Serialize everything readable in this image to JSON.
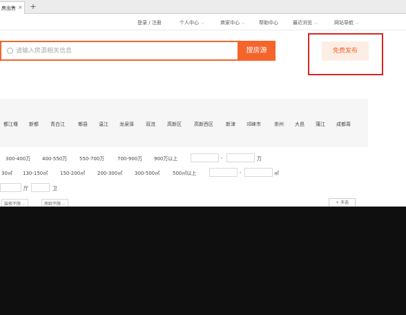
{
  "browser": {
    "tab_title": "房出售",
    "tab_close": "×",
    "new_tab": "+"
  },
  "topnav": {
    "login": "登录 / 注册",
    "personal": "个人中心",
    "merchant": "商家中心",
    "help": "帮助中心",
    "recent": "最近浏览",
    "sitemap": "网站导航",
    "chevron": "⌵"
  },
  "search": {
    "placeholder": "请输入房源相关信息",
    "button_label": "搜房源"
  },
  "publish": {
    "label": "免费发布"
  },
  "regions": [
    "都江堰",
    "新都",
    "青白江",
    "郫县",
    "温江",
    "龙泉驿",
    "双流",
    "高新区",
    "高新西区",
    "新津",
    "邛崃市",
    "崇州",
    "大邑",
    "蒲江",
    "成都周"
  ],
  "price": {
    "options": [
      "300-400万",
      "400-550万",
      "550-700万",
      "700-900万",
      "900万以上"
    ],
    "separator": "-",
    "unit": "万"
  },
  "area": {
    "options": [
      "30㎡",
      "130-150㎡",
      "150-200㎡",
      "200-300㎡",
      "300-500㎡",
      "500㎡以上"
    ],
    "separator": "-",
    "unit": "㎡"
  },
  "layout": {
    "hall_unit": "厅",
    "bath_unit": "卫"
  },
  "dropdowns": {
    "decoration": "装修不限",
    "property_type": "房龄不限",
    "chevron": "⌵"
  },
  "multi_select": "+ 多选"
}
